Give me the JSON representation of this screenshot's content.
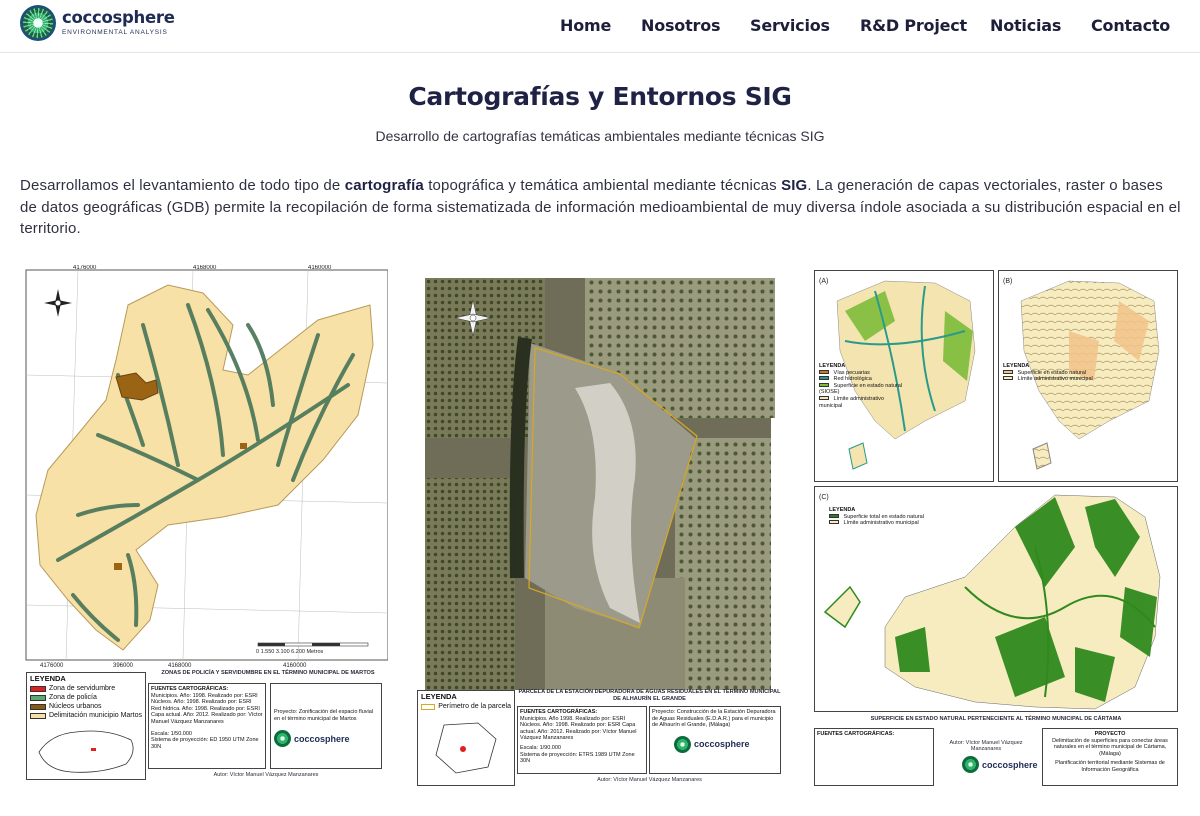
{
  "header": {
    "brand_name": "coccosphere",
    "brand_tagline": "ENVIRONMENTAL ANALYSIS",
    "nav": [
      {
        "label": "Home"
      },
      {
        "label": "Nosotros"
      },
      {
        "label": "Servicios"
      },
      {
        "label": "R&D Project"
      },
      {
        "label": "Noticias"
      },
      {
        "label": "Contacto"
      }
    ]
  },
  "main": {
    "title": "Cartografías y Entornos SIG",
    "subtitle": "Desarrollo de cartografías temáticas ambientales mediante técnicas SIG",
    "paragraph": {
      "p1": "Desarrollamos el levantamiento de todo tipo de ",
      "b1": "cartografía",
      "p2": " topográfica y temática ambiental mediante técnicas ",
      "b2": "SIG",
      "p3": ". La generación de capas vectoriales, raster o bases de datos geográficas (GDB) permite la recopilación de forma sistematizada de información medioambiental de muy diversa índole asociada a su distribución espacial en el territorio."
    }
  },
  "maps": {
    "map1": {
      "legend_title": "LEYENDA",
      "legend_items": [
        {
          "label": "Zona de servidumbre",
          "color": "#e02020"
        },
        {
          "label": "Zona de policía",
          "color": "#5aa874"
        },
        {
          "label": "Núcleos urbanos",
          "color": "#8a5a12"
        },
        {
          "label": "Delimitación municipio Martos",
          "color": "#f6e0a8"
        }
      ],
      "heading": "ZONAS DE POLICÍA Y SERVIDUMBRE EN EL TÉRMINO MUNICIPAL DE MARTOS",
      "sources_title": "FUENTES CARTOGRÁFICAS:",
      "sources": "Municipios. Año: 1998. Realizado por: ESRI Núcleos. Año: 1998. Realizado por: ESRI Red hídrica. Año: 1998. Realizado por: ESRI Capa actual. Año: 2012. Realizado por: Víctor Manuel Vázquez Manzanares",
      "scale": "Escala: 1/50.000",
      "projection": "Sistema de proyección: ED 1950 UTM Zone 30N",
      "project": "Proyecto: Zonificación del espacio fluvial en el término municipal de Martos",
      "author": "Autor: Víctor Manuel Vázquez Manzanares",
      "coords_top": [
        "4176000",
        "4168000",
        "4160000"
      ],
      "coords_bottom": [
        "4176000",
        "396000",
        "4168000",
        "4160000"
      ],
      "scale_bar": "0   1.550   3.100         6.200 Metros"
    },
    "map2": {
      "legend_title": "LEYENDA",
      "legend_item": "Perímetro de la parcela",
      "heading": "PARCELA DE LA ESTACIÓN DEPURADORA DE AGUAS RESIDUALES EN EL TÉRMINO MUNICIPAL DE ALHAURÍN EL GRANDE",
      "sources_title": "FUENTES CARTOGRÁFICAS:",
      "sources": "Municipios. Año 1998. Realizado por: ESRI Núcleos. Año: 1998. Realizado por: ESRI Capa actual. Año: 2012. Realizado por: Víctor Manuel Vázquez Manzanares",
      "scale": "Escala: 1/90.000",
      "projection": "Sistema de proyección: ETRS 1989 UTM Zone 30N",
      "project": "Proyecto: Construcción de la Estación Depuradora de Aguas Residuales (E.D.A.R.) para el municipio de Alhaurín el Grande, (Málaga)",
      "author": "Autor: Víctor Manuel Vázquez Manzanares"
    },
    "map3": {
      "panel_a": "(A)",
      "panel_b": "(B)",
      "panel_c": "(C)",
      "legend_title": "LEYENDA",
      "legend_a": [
        {
          "label": "Vías pecuarias",
          "color": "#c47a2a"
        },
        {
          "label": "Red hidrológica",
          "color": "#2a9a8a"
        },
        {
          "label": "Superficie en estado natural (SIOSE)",
          "color": "#7dbb3a"
        },
        {
          "label": "Límite administrativo municipal",
          "color": "#f4e4b0"
        }
      ],
      "legend_b": [
        {
          "label": "Superficie en estado natural",
          "color": "#f3c48a"
        },
        {
          "label": "Límite administrativo municipal",
          "color": "#f6ecc0"
        }
      ],
      "legend_c": [
        {
          "label": "Superficie total en estado natural",
          "color": "#2f7f1e"
        },
        {
          "label": "Límite administrativo municipal",
          "color": "#f6ecc0"
        }
      ],
      "heading": "SUPERFICIE EN ESTADO NATURAL PERTENECIENTE AL TÉRMINO MUNICIPAL DE CÁRTAMA",
      "sources_title": "FUENTES CARTOGRÁFICAS:",
      "author": "Autor: Víctor Manuel Vázquez Manzanares",
      "project_title": "PROYECTO",
      "project": "Delimitación de superficies para conectar áreas naturales en el término municipal de Cártama, (Málaga)",
      "project_sub": "Planificación territorial mediante Sistemas de Información Geográfica"
    }
  }
}
